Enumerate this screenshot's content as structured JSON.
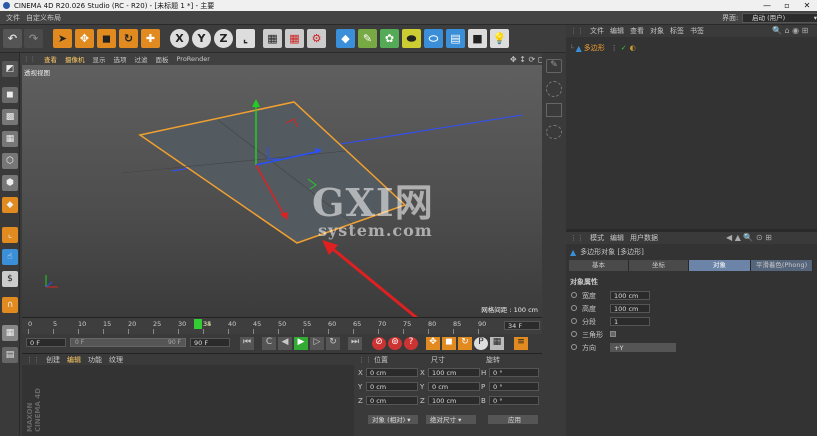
{
  "window": {
    "title": "CINEMA 4D R20.026 Studio (RC - R20) - [未标题 1 *] - 主要",
    "minimize": "—",
    "restore": "▫",
    "close": "✕"
  },
  "menubar": {
    "items": [
      "文件",
      "自定义布局"
    ],
    "interface_label": "界面:",
    "interface_value": "启动 (用户)"
  },
  "toolbar": {
    "xyz": [
      "X",
      "Y",
      "Z"
    ]
  },
  "viewport": {
    "menu": [
      "查看",
      "摄像机",
      "显示",
      "选项",
      "过滤",
      "面板",
      "ProRender"
    ],
    "label": "透视视图",
    "grid_spacing": "网格间距 : 100 cm",
    "watermark_main": "GXI网",
    "watermark_sub": "system.com"
  },
  "timeline": {
    "ticks": [
      "0",
      "5",
      "10",
      "15",
      "20",
      "25",
      "30",
      "35",
      "40",
      "45",
      "50",
      "55",
      "60",
      "65",
      "70",
      "75",
      "80",
      "85",
      "90"
    ],
    "current_frame_marker": "34",
    "end_field": "34 F",
    "current_frame": 34,
    "max_frame": 90
  },
  "transport": {
    "start": "0 F",
    "start2": "0 F",
    "end": "90 F",
    "end2": "90 F"
  },
  "materials": {
    "menu": [
      "创建",
      "编辑",
      "功能",
      "纹理"
    ],
    "side_label": "MAXON CINEMA 4D"
  },
  "coords": {
    "headers": [
      "位置",
      "尺寸",
      "旋转"
    ],
    "rows": [
      {
        "axis": "X",
        "pos": "0 cm",
        "size_axis": "X",
        "size": "100 cm",
        "rot_axis": "H",
        "rot": "0 °"
      },
      {
        "axis": "Y",
        "pos": "0 cm",
        "size_axis": "Y",
        "size": "0 cm",
        "rot_axis": "P",
        "rot": "0 °"
      },
      {
        "axis": "Z",
        "pos": "0 cm",
        "size_axis": "Z",
        "size": "100 cm",
        "rot_axis": "B",
        "rot": "0 °"
      }
    ],
    "mode": "对象 (相对)",
    "size_mode": "绝对尺寸",
    "apply": "应用"
  },
  "object_manager": {
    "menu": [
      "文件",
      "编辑",
      "查看",
      "对象",
      "标签",
      "书签"
    ],
    "object_name": "多边形"
  },
  "attributes": {
    "menu": [
      "模式",
      "编辑",
      "用户数据"
    ],
    "object_title": "多边形对象 [多边形]",
    "tabs": [
      "基本",
      "坐标",
      "对象",
      "平滑着色(Phong)"
    ],
    "section": "对象属性",
    "fields": [
      {
        "label": "宽度",
        "value": "100 cm"
      },
      {
        "label": "高度",
        "value": "100 cm"
      },
      {
        "label": "分段",
        "value": "1"
      },
      {
        "label": "三角形",
        "value": ""
      },
      {
        "label": "方向",
        "value": "+Y"
      }
    ]
  },
  "colors": {
    "accent": "#6b84a8",
    "selection_orange": "#f0a030",
    "arrow_red": "#e02020"
  }
}
